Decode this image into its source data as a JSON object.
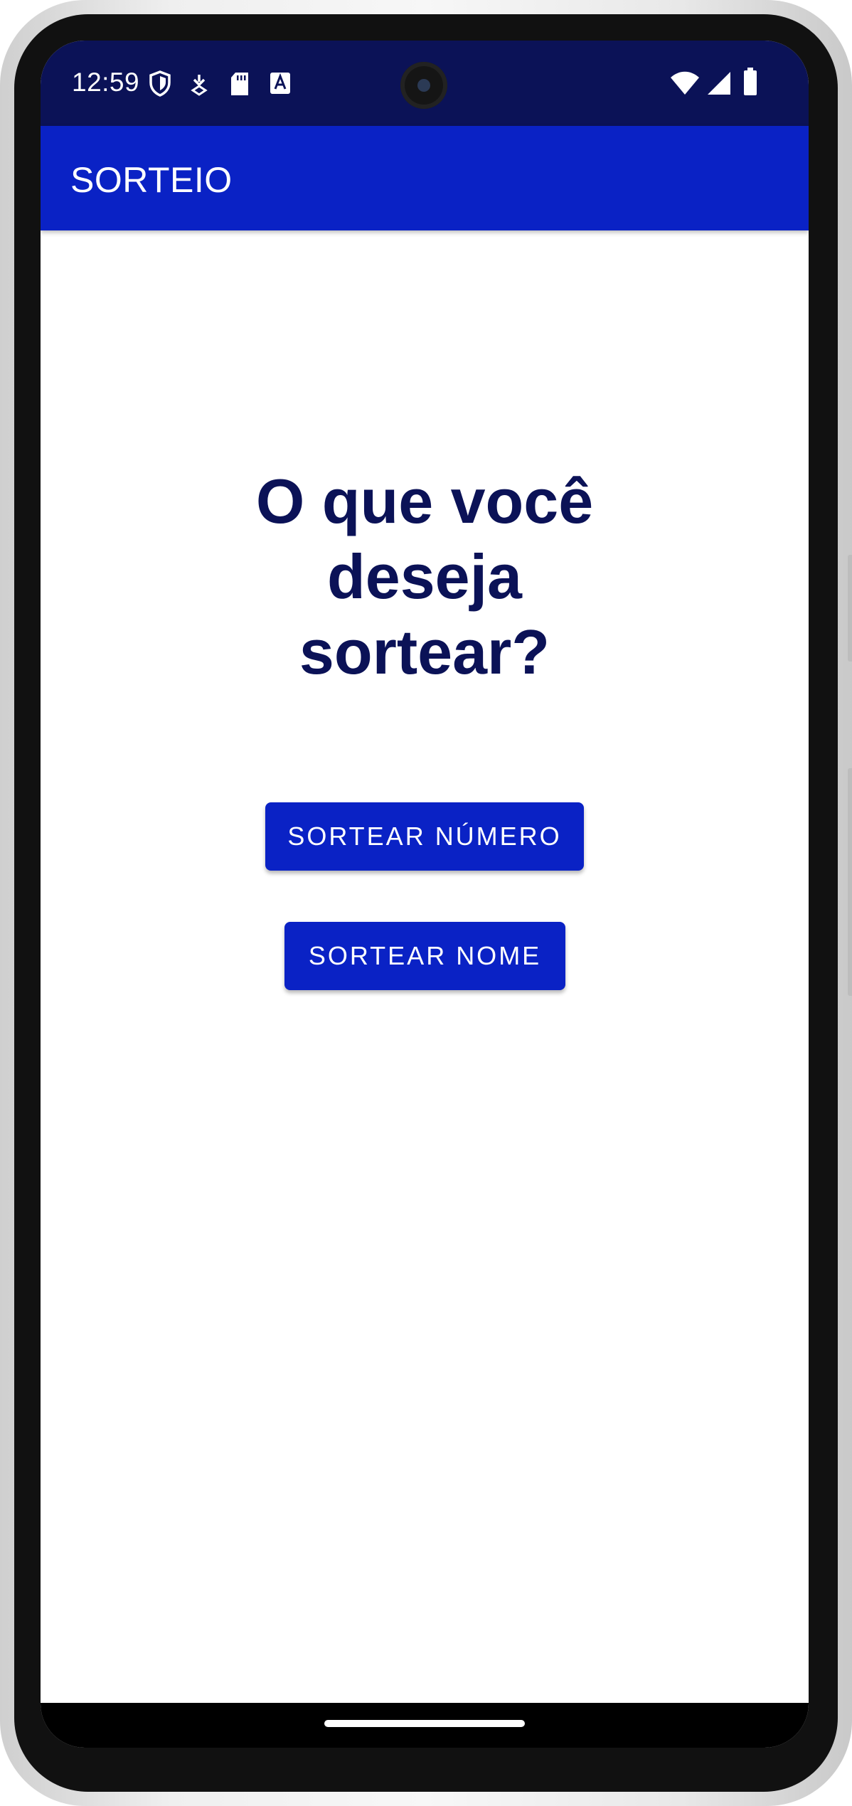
{
  "status_bar": {
    "time": "12:59",
    "left_icons": [
      "shield-icon",
      "download-icon",
      "sd-card-icon",
      "keyboard-icon"
    ],
    "right_icons": [
      "wifi-icon",
      "signal-icon",
      "battery-icon"
    ],
    "color": "#0b1257"
  },
  "app_bar": {
    "title": "SORTEIO",
    "color": "#0a22c5"
  },
  "main": {
    "heading": "O que você deseja sortear?",
    "heading_color": "#0b1257",
    "buttons": {
      "numero_label": "SORTEAR NÚMERO",
      "nome_label": "SORTEAR NOME"
    },
    "button_color": "#0a22c5"
  }
}
